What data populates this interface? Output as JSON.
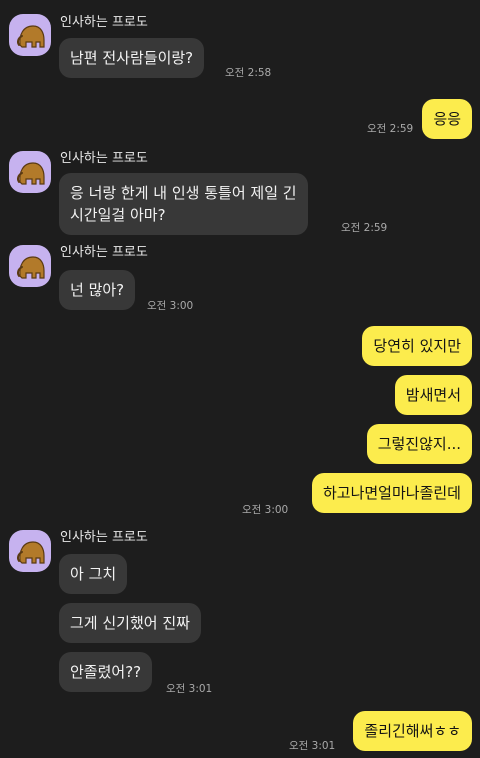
{
  "theme": {
    "background": "#1d1d1d",
    "incoming_bubble": "#383838",
    "outgoing_bubble": "#fcec4d",
    "avatar_background": "#c6b2ef"
  },
  "contact": {
    "name": "인사하는 프로도",
    "avatar_icon": "elephant-icon"
  },
  "messages": [
    {
      "dir": "in",
      "text": "남편 전사람들이랑?",
      "time": "오전 2:58"
    },
    {
      "dir": "out",
      "text": "응응",
      "time": "오전 2:59"
    },
    {
      "dir": "in",
      "text": "응 너랑 한게 내 인생 통틀어 제일 긴\n시간일걸 아마?",
      "time": "오전 2:59"
    },
    {
      "dir": "in",
      "text": "넌 많아?",
      "time": "오전 3:00"
    },
    {
      "dir": "out",
      "text": "당연히 있지만",
      "time": ""
    },
    {
      "dir": "out",
      "text": "밤새면서",
      "time": ""
    },
    {
      "dir": "out",
      "text": "그렇진않지...",
      "time": ""
    },
    {
      "dir": "out",
      "text": "하고나면얼마나졸린데",
      "time": "오전 3:00"
    },
    {
      "dir": "in",
      "text": "아 그치",
      "time": ""
    },
    {
      "dir": "in",
      "text": "그게 신기했어 진짜",
      "time": ""
    },
    {
      "dir": "in",
      "text": "안졸렸어??",
      "time": "오전 3:01"
    },
    {
      "dir": "out",
      "text": "졸리긴해써ㅎㅎ",
      "time": "오전 3:01"
    }
  ]
}
